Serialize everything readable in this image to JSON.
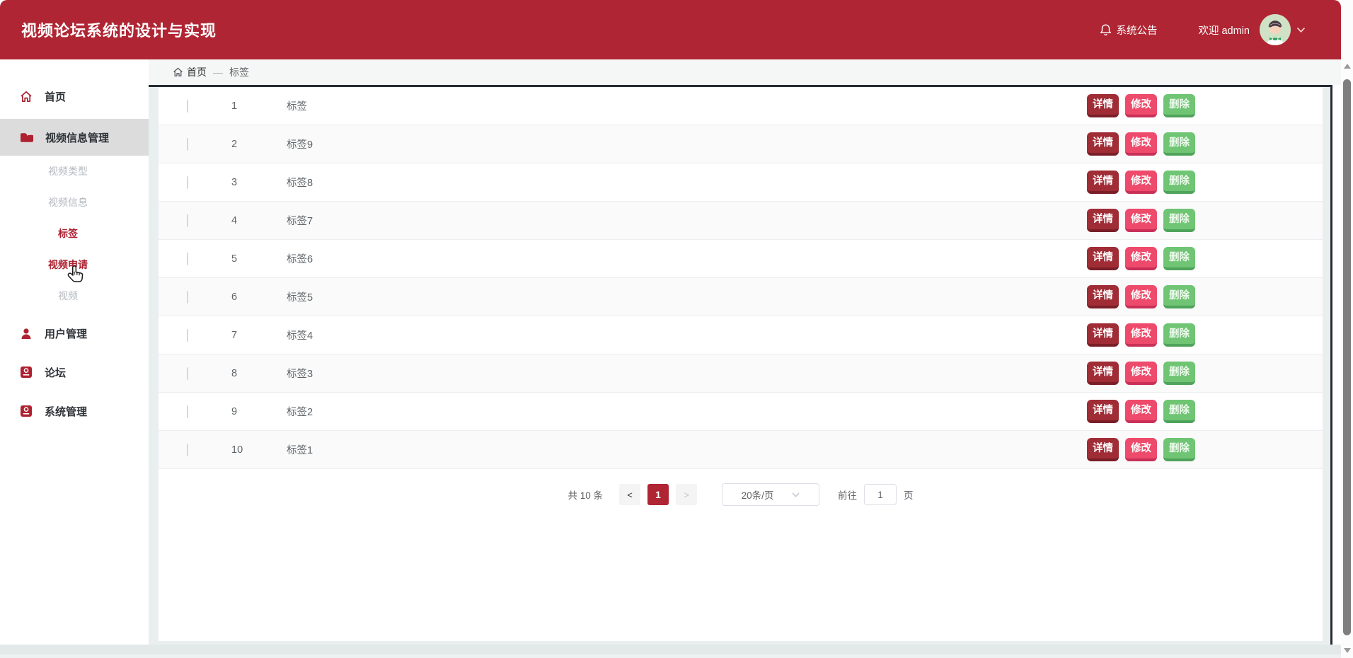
{
  "header": {
    "title": "视频论坛系统的设计与实现",
    "notice": "系统公告",
    "welcome": "欢迎 admin"
  },
  "breadcrumb": {
    "home": "首页",
    "separator": "—",
    "current": "标签"
  },
  "sidebar": {
    "items": [
      {
        "label": "首页"
      },
      {
        "label": "视频信息管理",
        "children": [
          "视频类型",
          "视频信息",
          "标签",
          "视频申请",
          "视频"
        ]
      },
      {
        "label": "用户管理"
      },
      {
        "label": "论坛"
      },
      {
        "label": "系统管理"
      }
    ]
  },
  "table": {
    "rows": [
      {
        "no": "1",
        "label": "标签"
      },
      {
        "no": "2",
        "label": "标签9"
      },
      {
        "no": "3",
        "label": "标签8"
      },
      {
        "no": "4",
        "label": "标签7"
      },
      {
        "no": "5",
        "label": "标签6"
      },
      {
        "no": "6",
        "label": "标签5"
      },
      {
        "no": "7",
        "label": "标签4"
      },
      {
        "no": "8",
        "label": "标签3"
      },
      {
        "no": "9",
        "label": "标签2"
      },
      {
        "no": "10",
        "label": "标签1"
      }
    ],
    "actions": {
      "detail": "详情",
      "edit": "修改",
      "delete": "删除"
    }
  },
  "pagination": {
    "total": "共 10 条",
    "prev": "<",
    "current_page": "1",
    "next": ">",
    "page_size": "20条/页",
    "goto_label": "前往",
    "goto_value": "1",
    "unit": "页"
  },
  "colors": {
    "header_red": "#b02533",
    "accent_red": "#ad2130",
    "detail_button": "#a02c36",
    "edit_button": "#ee4a6b",
    "delete_button": "#6fc573",
    "content_bg": "#e9eeee"
  }
}
